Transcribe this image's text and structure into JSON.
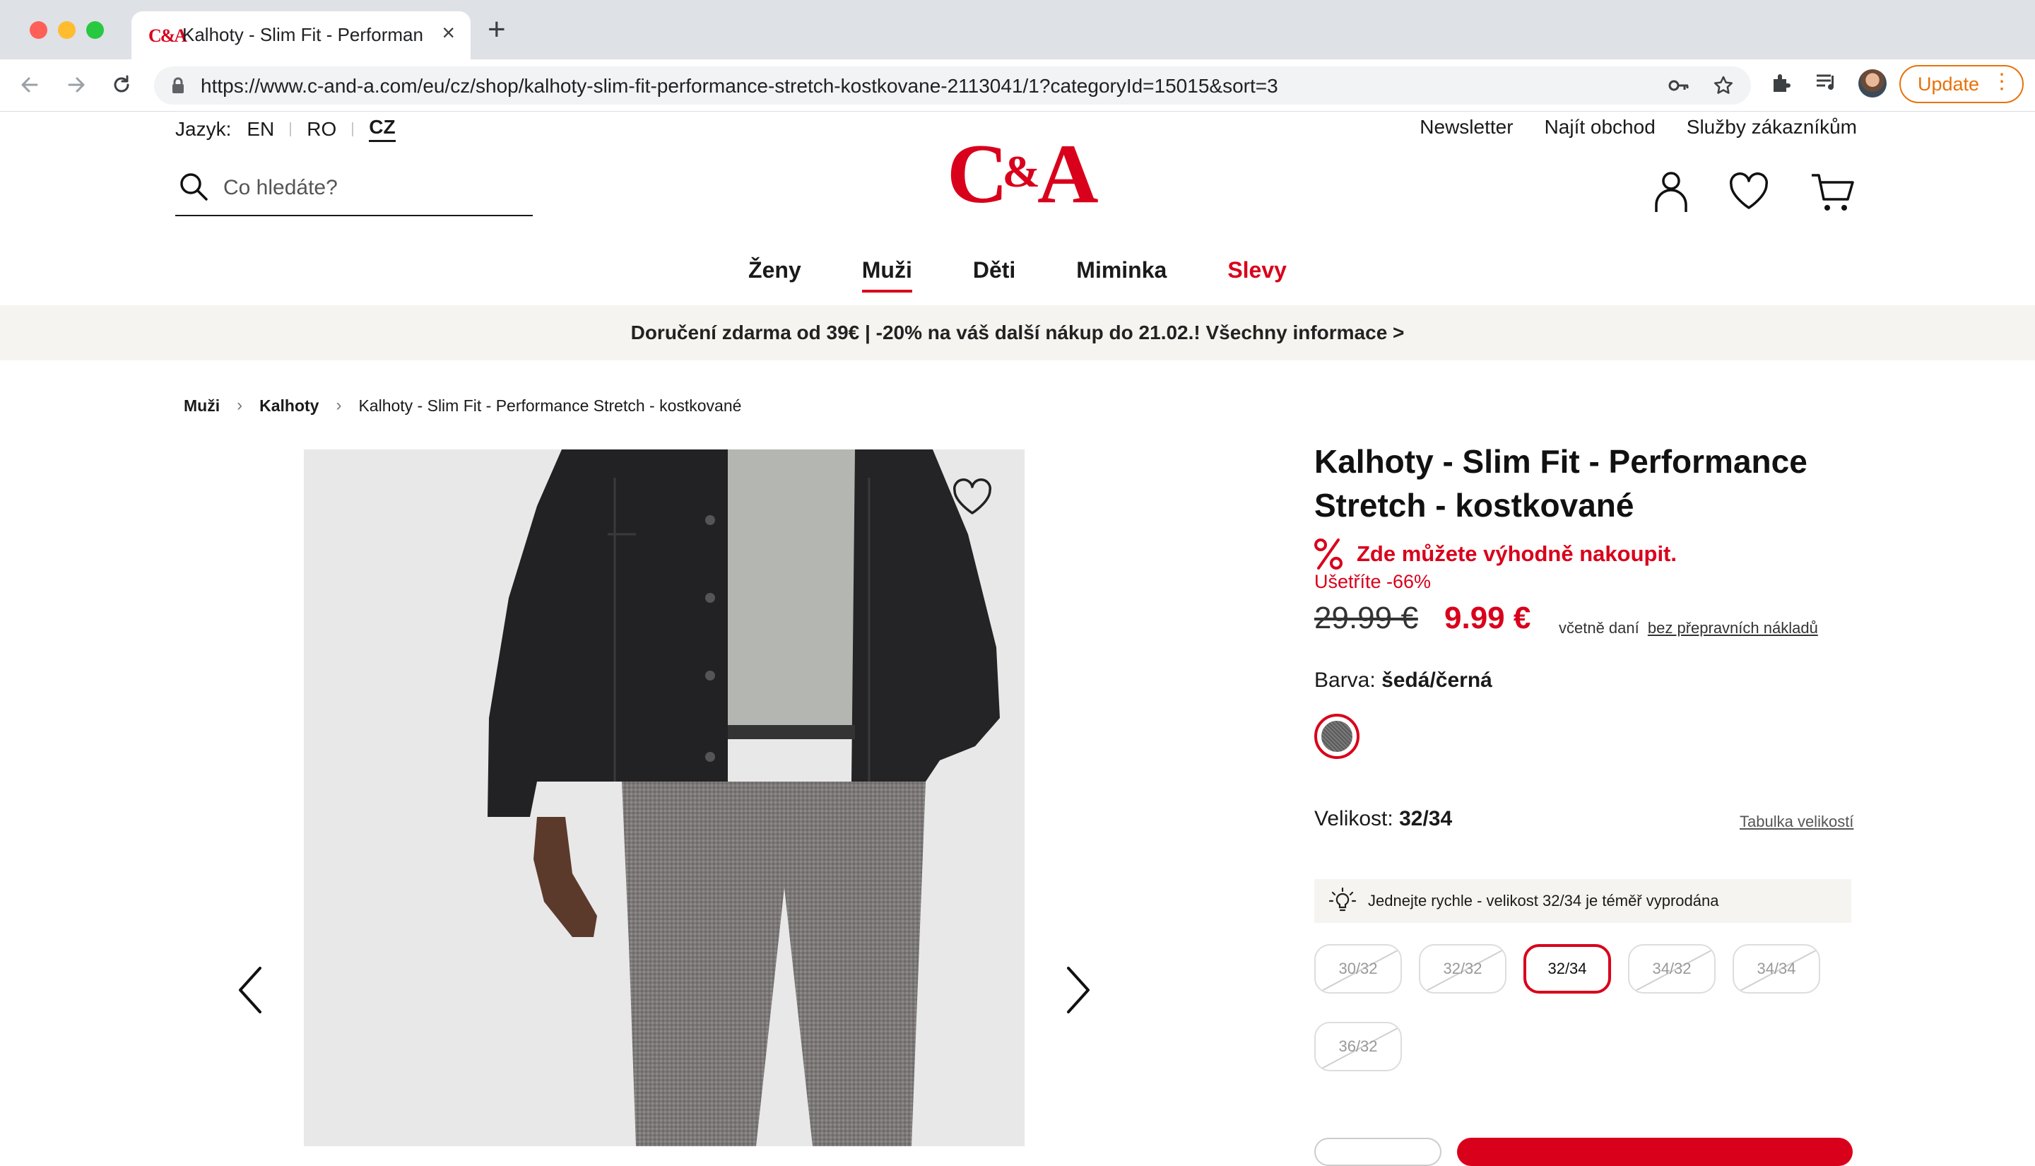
{
  "browser": {
    "tab_title": "Kalhoty - Slim Fit - Performance Stretch - kostkované",
    "favicon_text": "C&A",
    "url": "https://www.c-and-a.com/eu/cz/shop/kalhoty-slim-fit-performance-stretch-kostkovane-2113041/1?categoryId=15015&sort=3",
    "update_label": "Update"
  },
  "header": {
    "lang_label": "Jazyk:",
    "langs": [
      "EN",
      "RO",
      "CZ"
    ],
    "active_lang": "CZ",
    "top_links": [
      "Newsletter",
      "Najít obchod",
      "Služby zákazníkům"
    ],
    "search_placeholder": "Co hledáte?",
    "logo_left": "C",
    "logo_amp": "&",
    "logo_right": "A"
  },
  "nav": {
    "items": [
      "Ženy",
      "Muži",
      "Děti",
      "Miminka",
      "Slevy"
    ],
    "active": "Muži"
  },
  "banner": {
    "text": "Doručení zdarma od 39€ | -20% na váš další nákup do 21.02.! Všechny informace >"
  },
  "breadcrumb": [
    "Muži",
    "Kalhoty",
    "Kalhoty - Slim Fit - Performance Stretch - kostkované"
  ],
  "product": {
    "title": "Kalhoty - Slim Fit - Performance Stretch - kostkované",
    "promo": "Zde můžete výhodně nakoupit.",
    "savings": "Ušetříte -66%",
    "old_price": "29.99 €",
    "price": "9.99 €",
    "tax_note": "včetně daní",
    "shipping_link": "bez přepravních nákladů",
    "color_label": "Barva:",
    "color_value": "šedá/černá",
    "size_label": "Velikost:",
    "size_value": "32/34",
    "size_chart_link": "Tabulka velikostí",
    "hint": "Jednejte rychle - velikost 32/34 je téměř vyprodána",
    "sizes": [
      {
        "label": "30/32",
        "available": false
      },
      {
        "label": "32/32",
        "available": false
      },
      {
        "label": "32/34",
        "available": true,
        "selected": true
      },
      {
        "label": "34/32",
        "available": false
      },
      {
        "label": "34/34",
        "available": false
      },
      {
        "label": "36/32",
        "available": false
      }
    ]
  },
  "colors": {
    "brand_red": "#d9001b",
    "banner_bg": "#f5f4f0"
  }
}
